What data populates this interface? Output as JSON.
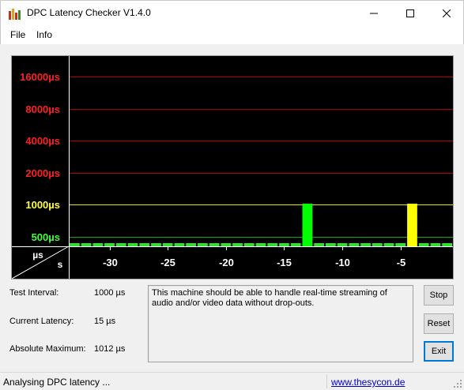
{
  "window": {
    "title": "DPC Latency Checker V1.4.0"
  },
  "menu": {
    "items": [
      "File",
      "Info"
    ]
  },
  "chart_data": {
    "type": "bar",
    "scale": "log",
    "y_tick_labels": [
      {
        "label": "16000µs",
        "value": 16000,
        "color": "#ff2020"
      },
      {
        "label": "8000µs",
        "value": 8000,
        "color": "#ff2020"
      },
      {
        "label": "4000µs",
        "value": 4000,
        "color": "#ff2020"
      },
      {
        "label": "2000µs",
        "value": 2000,
        "color": "#ff2020"
      },
      {
        "label": "1000µs",
        "value": 1000,
        "color": "#ffff40"
      },
      {
        "label": "500µs",
        "value": 500,
        "color": "#40ff40"
      }
    ],
    "gridlines": [
      {
        "value": 16000,
        "color": "#b00000"
      },
      {
        "value": 8000,
        "color": "#b00000"
      },
      {
        "value": 4000,
        "color": "#b00000"
      },
      {
        "value": 2000,
        "color": "#b00000"
      },
      {
        "value": 1000,
        "color": "#e6e600"
      },
      {
        "value": 500,
        "color": "#00b000"
      }
    ],
    "axis_unit_label_top": "µs",
    "axis_unit_label_bottom": "s",
    "x_tick_labels": [
      "-30",
      "-25",
      "-20",
      "-15",
      "-10",
      "-5"
    ],
    "x_ticks": [
      -30,
      -25,
      -20,
      -15,
      -10,
      -5
    ],
    "xlim": [
      -33,
      0
    ],
    "x": [
      -33,
      -32,
      -31,
      -30,
      -29,
      -28,
      -27,
      -26,
      -25,
      -24,
      -23,
      -22,
      -21,
      -20,
      -19,
      -18,
      -17,
      -16,
      -15,
      -14,
      -13,
      -12,
      -11,
      -10,
      -9,
      -8,
      -7,
      -6,
      -5,
      -4,
      -3,
      -2,
      -1
    ],
    "values": [
      15,
      15,
      15,
      15,
      15,
      15,
      15,
      15,
      17,
      15,
      17,
      22,
      15,
      15,
      15,
      15,
      15,
      15,
      15,
      15,
      1012,
      15,
      15,
      15,
      15,
      15,
      15,
      15,
      17,
      1012,
      15,
      15,
      15
    ],
    "bar_colors": {
      "normal": "#33dd33",
      "high": "#00ff00",
      "warn": "#ffff00"
    },
    "warn_index": 29,
    "high_index": 20
  },
  "info": {
    "test_interval_label": "Test Interval:",
    "test_interval_value": "1000 µs",
    "current_latency_label": "Current Latency:",
    "current_latency_value": "15 µs",
    "absolute_maximum_label": "Absolute Maximum:",
    "absolute_maximum_value": "1012 µs"
  },
  "message": "This machine should be able to handle real-time streaming of audio and/or video data without drop-outs.",
  "buttons": {
    "stop": "Stop",
    "reset": "Reset",
    "exit": "Exit"
  },
  "status": {
    "text": "Analysing DPC latency ...",
    "link": "www.thesycon.de"
  }
}
